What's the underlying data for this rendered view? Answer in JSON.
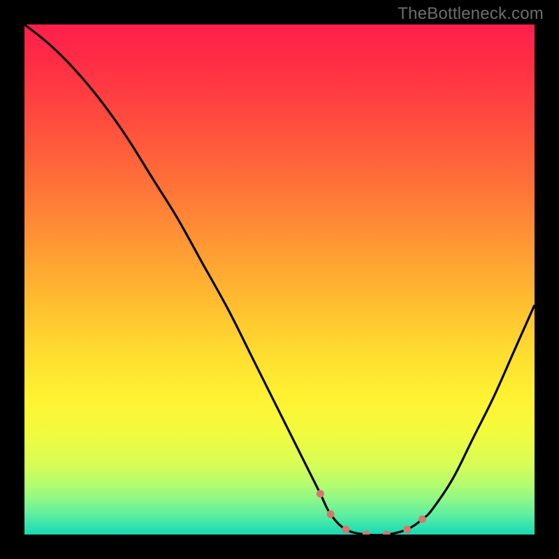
{
  "watermark": "TheBottleneck.com",
  "chart_data": {
    "type": "line",
    "title": "",
    "xlabel": "",
    "ylabel": "",
    "xlim": [
      0,
      100
    ],
    "ylim": [
      0,
      100
    ],
    "grid": false,
    "series": [
      {
        "name": "bottleneck-curve",
        "x": [
          0,
          5,
          10,
          15,
          20,
          25,
          30,
          35,
          40,
          45,
          50,
          55,
          58,
          60,
          63,
          67,
          71,
          75,
          78,
          80,
          84,
          88,
          92,
          96,
          100
        ],
        "values": [
          100,
          96,
          91,
          85,
          78,
          70,
          62,
          53,
          44,
          34,
          24,
          14,
          8,
          4,
          1,
          0,
          0,
          1,
          3,
          5,
          11,
          19,
          27,
          36,
          45
        ]
      }
    ],
    "highlight": {
      "name": "optimal-range",
      "color": "#d9766e",
      "x": [
        58,
        60,
        63,
        67,
        71,
        75,
        78
      ],
      "values": [
        8,
        4,
        1,
        0,
        0,
        1,
        3
      ]
    },
    "background_gradient": {
      "stops": [
        {
          "offset": 0.0,
          "color": "#ff1f4b"
        },
        {
          "offset": 0.06,
          "color": "#ff2a46"
        },
        {
          "offset": 0.15,
          "color": "#ff4140"
        },
        {
          "offset": 0.25,
          "color": "#ff5e3b"
        },
        {
          "offset": 0.35,
          "color": "#ff7d37"
        },
        {
          "offset": 0.45,
          "color": "#ff9e33"
        },
        {
          "offset": 0.55,
          "color": "#ffbf30"
        },
        {
          "offset": 0.65,
          "color": "#ffde30"
        },
        {
          "offset": 0.73,
          "color": "#fff232"
        },
        {
          "offset": 0.8,
          "color": "#f2fb3d"
        },
        {
          "offset": 0.86,
          "color": "#d9fd55"
        },
        {
          "offset": 0.9,
          "color": "#b6fc6d"
        },
        {
          "offset": 0.93,
          "color": "#8ff887"
        },
        {
          "offset": 0.96,
          "color": "#5fef9f"
        },
        {
          "offset": 0.985,
          "color": "#30e2af"
        },
        {
          "offset": 1.0,
          "color": "#16d9b4"
        }
      ]
    }
  }
}
